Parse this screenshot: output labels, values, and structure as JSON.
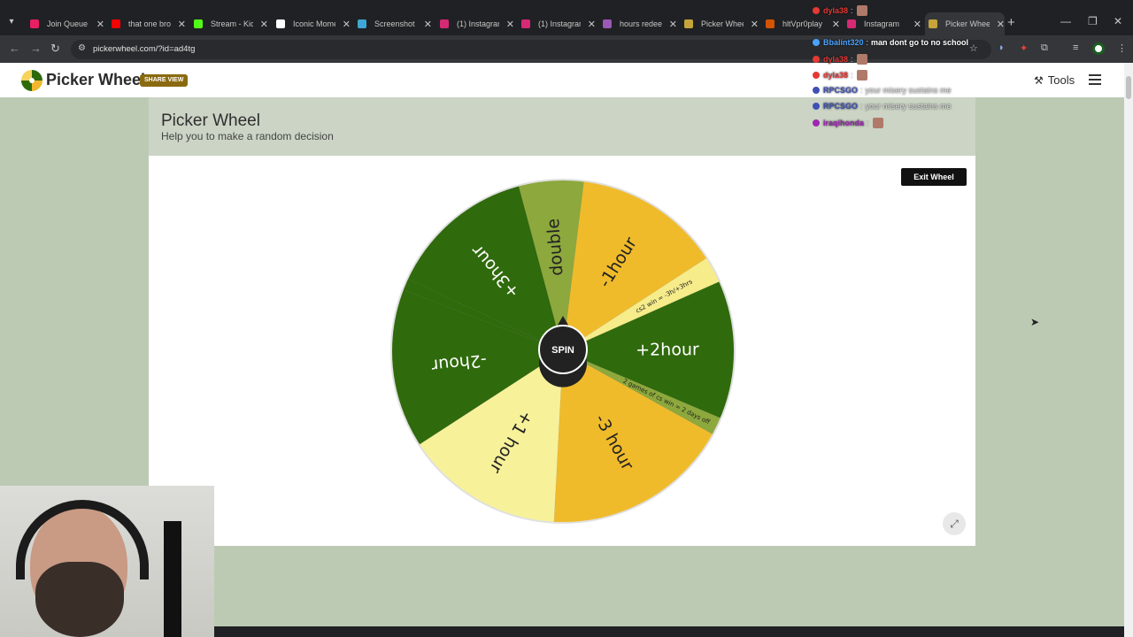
{
  "browser": {
    "tabs": [
      {
        "title": "Join Queue",
        "color": "#e91e63",
        "active": false
      },
      {
        "title": "that one bro",
        "color": "#ff0000",
        "active": false
      },
      {
        "title": "Stream - Kic",
        "color": "#53fc18",
        "active": false
      },
      {
        "title": "Iconic Mome",
        "color": "#ffffff",
        "active": false
      },
      {
        "title": "Screenshot",
        "color": "#3fa7d6",
        "active": false
      },
      {
        "title": "(1) Instagram",
        "color": "#d62976",
        "active": false
      },
      {
        "title": "(1) Instagram",
        "color": "#d62976",
        "active": false
      },
      {
        "title": "hours redeem",
        "color": "#9b59b6",
        "active": false
      },
      {
        "title": "Picker Whee",
        "color": "#c5a53a",
        "active": false
      },
      {
        "title": "hltVpr0play",
        "color": "#d35400",
        "active": false
      },
      {
        "title": "Instagram",
        "color": "#d62976",
        "active": false
      },
      {
        "title": "Picker Whee",
        "color": "#c5a53a",
        "active": true
      }
    ],
    "url": "pickerwheel.com/?id=ad4tg"
  },
  "header": {
    "brand": "Picker Wheel",
    "share_badge": "SHARE VIEW",
    "tools_label": "Tools"
  },
  "page": {
    "title": "Picker Wheel",
    "subtitle": "Help you to make a random decision"
  },
  "wheel": {
    "exit_label": "Exit Wheel",
    "spin_label": "SPIN",
    "segments": [
      {
        "label": "-1hour",
        "color": "#f0bb2b"
      },
      {
        "label": "cs2 win = -3h/+3hrs",
        "color": "#f6ec8a"
      },
      {
        "label": "+2hour",
        "color": "#2f6a0c"
      },
      {
        "label": "2 games of cs win = 2 days off",
        "color": "#8da83c"
      },
      {
        "label": "-3 hour",
        "color": "#f0bb2b"
      },
      {
        "label": "+1 hour",
        "color": "#f7f19a"
      },
      {
        "label": "-2hour",
        "color": "#2f6a0c"
      },
      {
        "label": "",
        "color": "#2f6a0c"
      },
      {
        "label": "+3hour",
        "color": "#2f6a0c"
      },
      {
        "label": "double",
        "color": "#8da83c"
      }
    ]
  },
  "chat": [
    {
      "user": "dyla38",
      "user_color": "#e53935",
      "message": "",
      "emote": true
    },
    {
      "user": "Bbalint320",
      "user_color": "#4aa3ff",
      "message": "man dont go to no school",
      "emote": false,
      "msg_color": "#ffffff"
    },
    {
      "user": "dyla38",
      "user_color": "#e53935",
      "message": "",
      "emote": true
    },
    {
      "user": "dyla38",
      "user_color": "#e53935",
      "message": "",
      "emote": true
    },
    {
      "user": "RPCSGO",
      "user_color": "#3f51b5",
      "message": "your misery sustains me",
      "emote": false
    },
    {
      "user": "RPCSGO",
      "user_color": "#3f51b5",
      "message": "your misery sustains me",
      "emote": false
    },
    {
      "user": "iraqihonda",
      "user_color": "#9c27b0",
      "message": "",
      "emote": true
    }
  ]
}
